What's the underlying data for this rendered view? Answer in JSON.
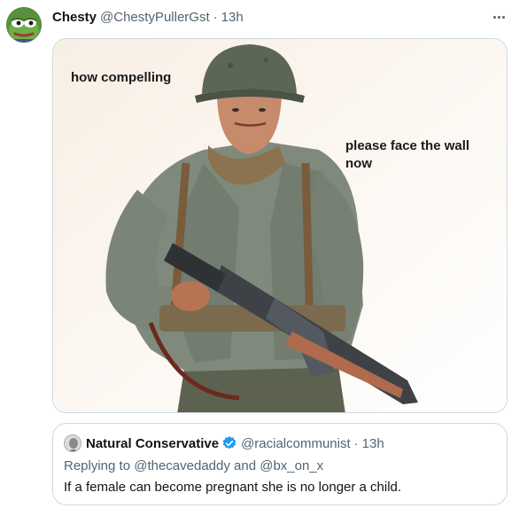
{
  "tweet": {
    "author": {
      "display_name": "Chesty",
      "handle": "@ChestyPullerGst",
      "separator": "·",
      "time": "13h",
      "avatar_icon": "pepe-frog-avatar"
    },
    "more_icon": "more-options-icon",
    "media": {
      "image_subject": "ww2-soldier-illustration",
      "caption_left": "how compelling",
      "caption_right": "please face the wall now"
    },
    "quote": {
      "author": {
        "display_name": "Natural Conservative",
        "handle": "@racialcommunist",
        "separator": "·",
        "time": "13h",
        "verified": true,
        "verified_color": "#1d9bf0"
      },
      "replying_prefix": "Replying to",
      "reply_to_1": "@thecavedaddy",
      "reply_conjunction": "and",
      "reply_to_2": "@bx_on_x",
      "text": "If a female can become pregnant she is no longer a child."
    }
  },
  "colors": {
    "primary_text": "#0f1419",
    "secondary_text": "#536471",
    "border": "#cfd9de",
    "accent": "#1d9bf0"
  }
}
